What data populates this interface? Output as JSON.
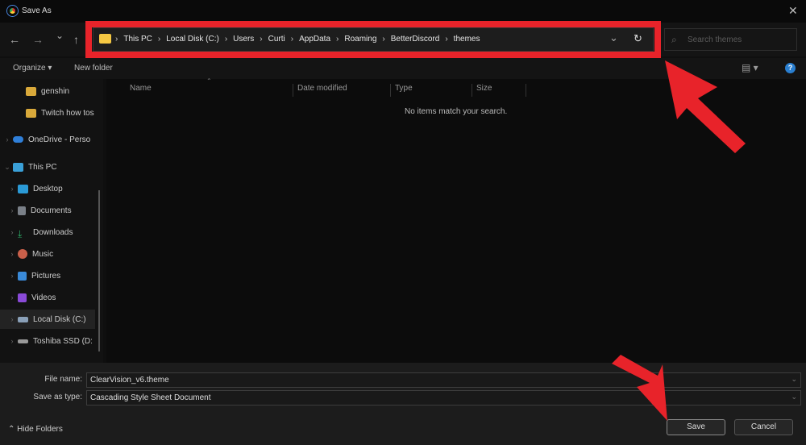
{
  "window": {
    "title": "Save As",
    "close": "✕"
  },
  "nav": {
    "back": "←",
    "forward": "→",
    "recent": "⌄",
    "up": "↑"
  },
  "address": {
    "crumbs": [
      "This PC",
      "Local Disk (C:)",
      "Users",
      "Curti",
      "AppData",
      "Roaming",
      "BetterDiscord",
      "themes"
    ],
    "dropdown": "⌄",
    "refresh": "↻"
  },
  "search": {
    "placeholder": "Search themes"
  },
  "command": {
    "organize": "Organize ▾",
    "new_folder": "New folder",
    "view": "▤ ▾",
    "help": "?"
  },
  "sidebar": {
    "items": [
      {
        "label": "genshin",
        "color": "#d9a93a"
      },
      {
        "label": "Twitch how tos",
        "color": "#d9a93a"
      },
      {
        "label": "OneDrive - Perso",
        "color": "#2f7fd8"
      },
      {
        "label": "This PC",
        "color": "#3aa0d8"
      },
      {
        "label": "Desktop",
        "color": "#2b9ad6"
      },
      {
        "label": "Documents",
        "color": "#7a8088"
      },
      {
        "label": "Downloads",
        "color": "#2db36a"
      },
      {
        "label": "Music",
        "color": "#c9604a"
      },
      {
        "label": "Pictures",
        "color": "#3a8ad8"
      },
      {
        "label": "Videos",
        "color": "#8a4ad8"
      },
      {
        "label": "Local Disk (C:)",
        "color": "#8aa0b8"
      },
      {
        "label": "Toshiba SSD (D:",
        "color": "#999999"
      }
    ]
  },
  "columns": [
    "Name",
    "Date modified",
    "Type",
    "Size"
  ],
  "empty_message": "No items match your search.",
  "form": {
    "file_name_label": "File name:",
    "file_name": "ClearVision_v6.theme",
    "type_label": "Save as type:",
    "type": "Cascading Style Sheet Document"
  },
  "footer": {
    "hide_folders": "Hide Folders",
    "save": "Save",
    "cancel": "Cancel"
  },
  "annotation_color": "#e8232a"
}
